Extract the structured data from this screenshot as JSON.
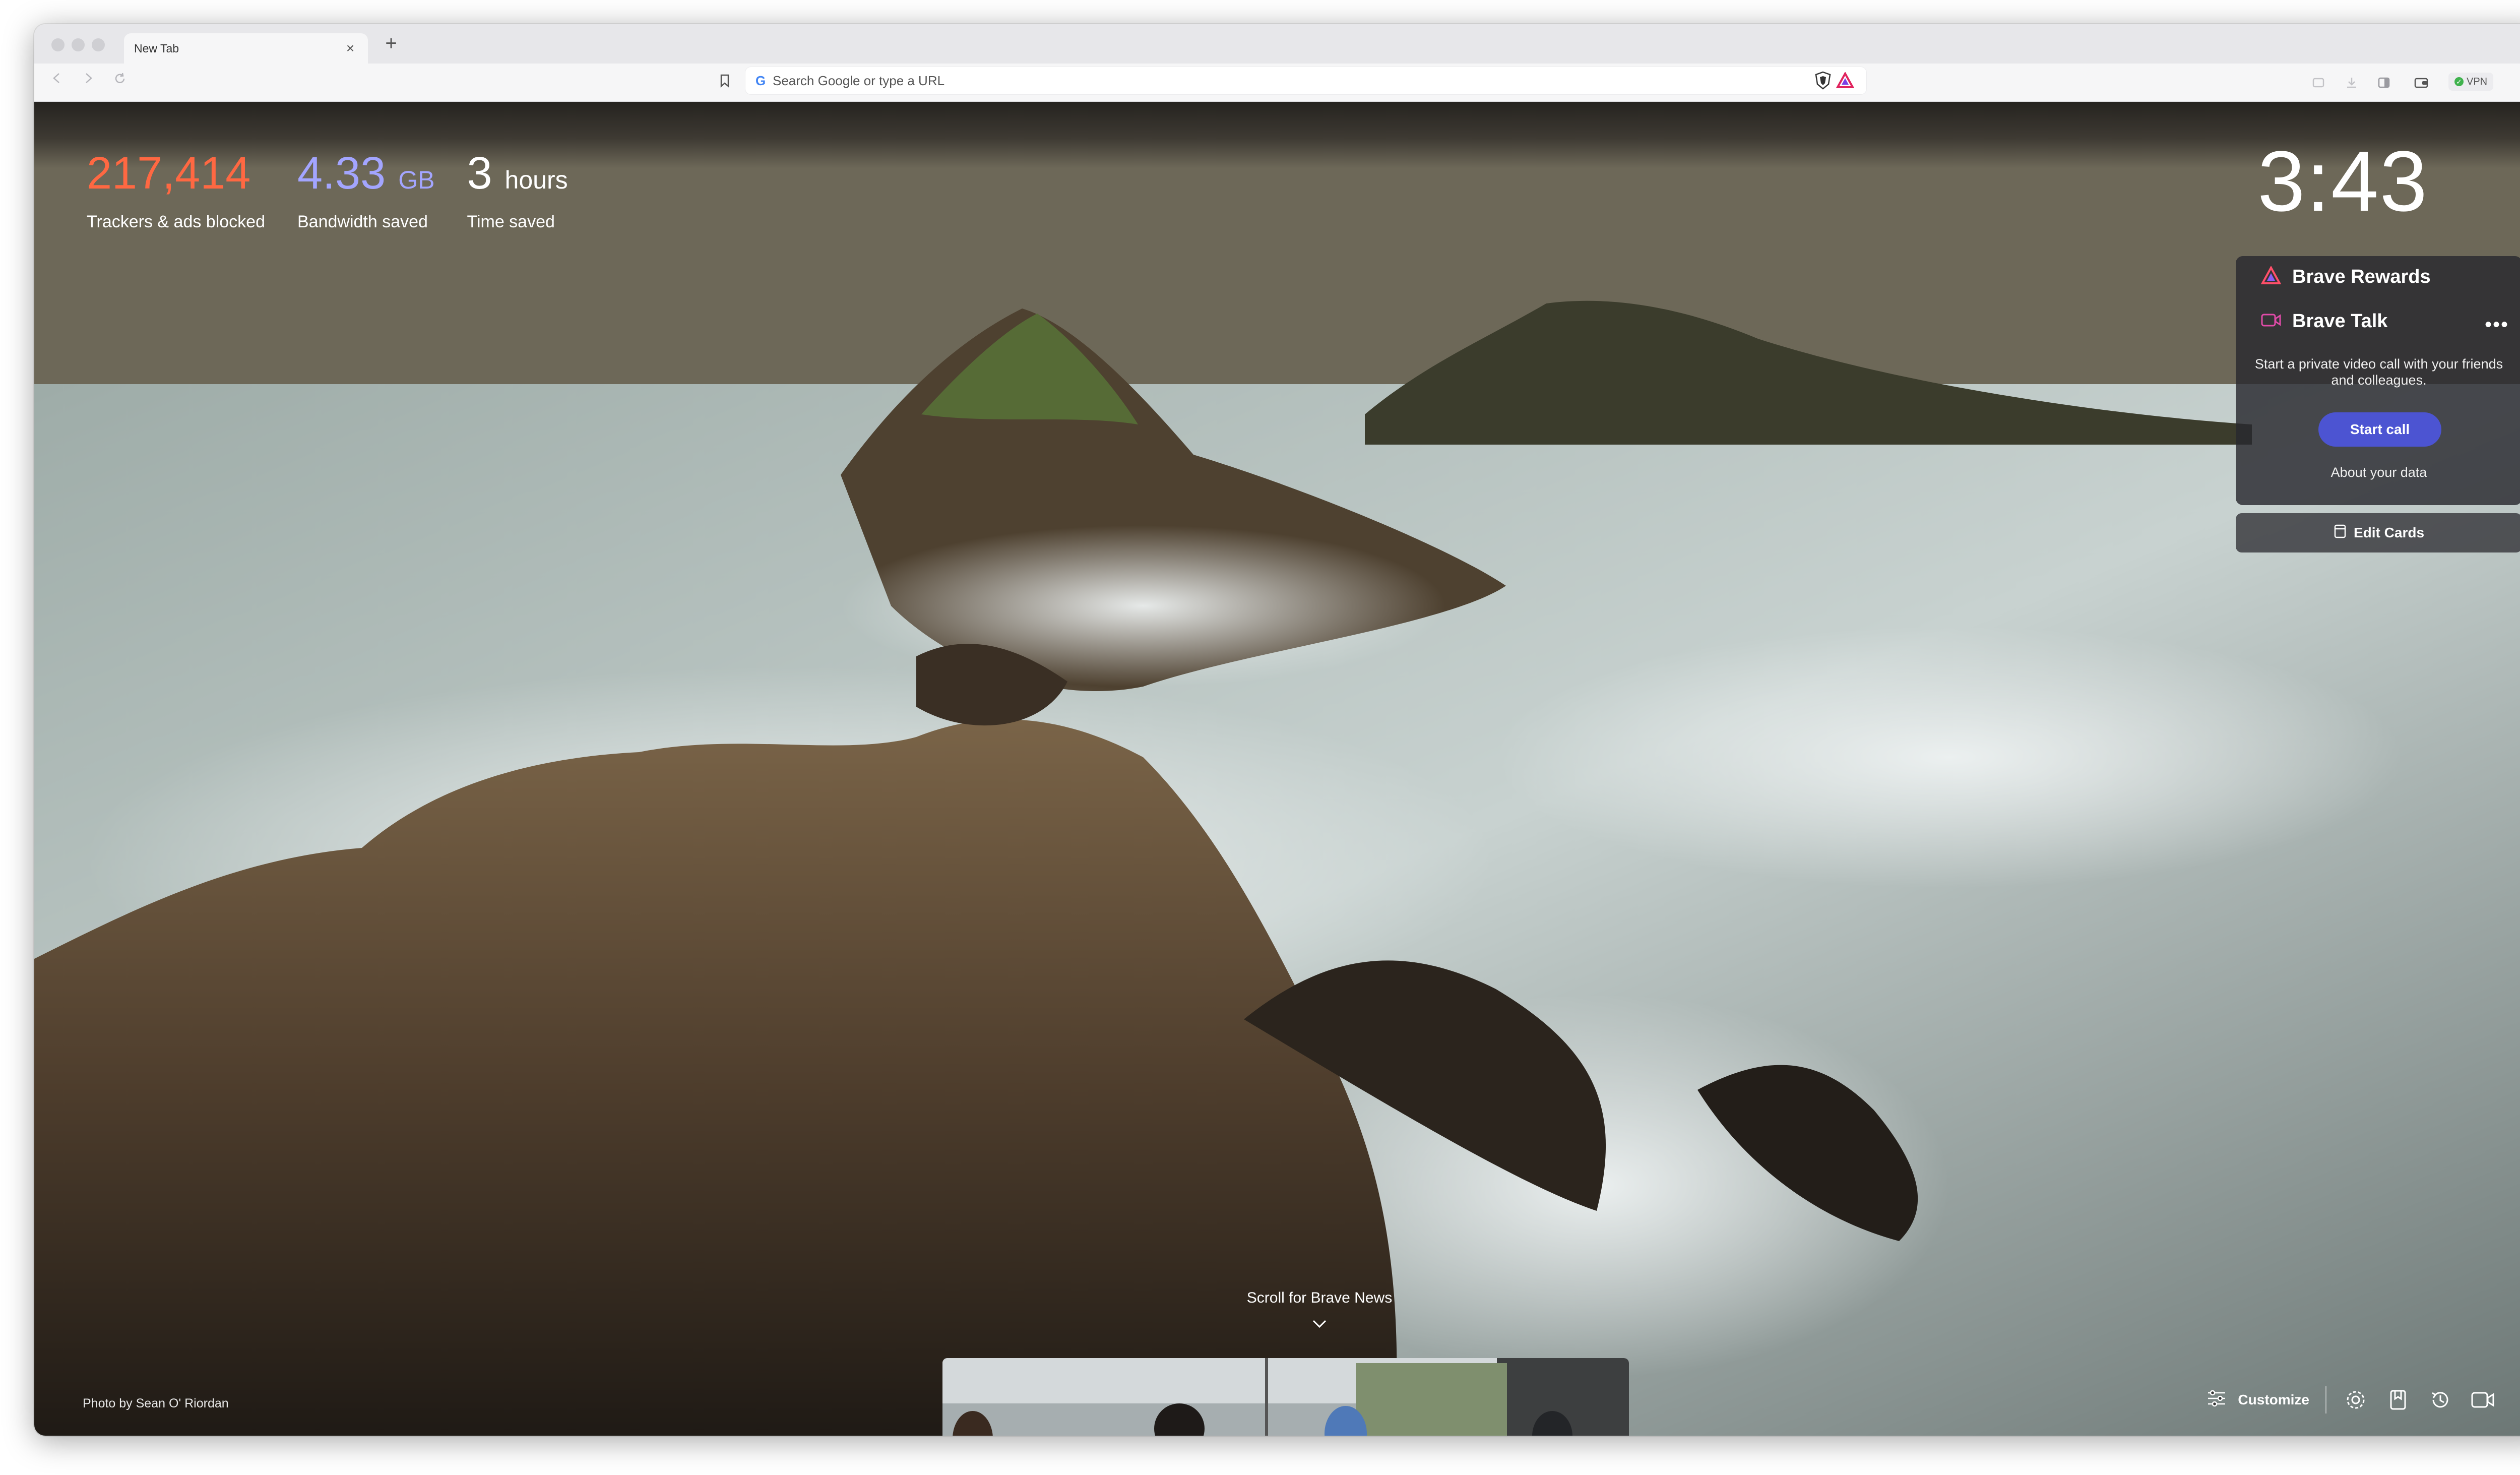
{
  "browser": {
    "tab_title": "New Tab",
    "tab_close": "×",
    "new_tab": "+",
    "omnibox_placeholder": "Search Google or type a URL",
    "omnibox_engine_glyph": "G",
    "vpn_label": "VPN",
    "vpn_check": "✓"
  },
  "stats": [
    {
      "value": "217,414",
      "unit": "",
      "label": "Trackers & ads blocked",
      "color": "#ff6842"
    },
    {
      "value": "4.33",
      "unit": "GB",
      "label": "Bandwidth saved",
      "color": "#a3a5ff"
    },
    {
      "value": "3",
      "unit": "hours",
      "label": "Time saved",
      "color": "#ffffff"
    }
  ],
  "clock": "3:43",
  "widget": {
    "rewards_title": "Brave Rewards",
    "talk_title": "Brave Talk",
    "more_glyph": "•••",
    "talk_desc": "Start a private video call with your friends and colleagues.",
    "start_call": "Start call",
    "about_data": "About your data",
    "edit_cards": "Edit Cards"
  },
  "scroll_news": "Scroll for Brave News",
  "photo_credit": "Photo by Sean O' Riordan",
  "customize": "Customize",
  "colors": {
    "accent": "#4c54d2",
    "brave_orange": "#ff6842",
    "bandwidth_purple": "#a3a5ff"
  },
  "icons": [
    "back-icon",
    "forward-icon",
    "reload-icon",
    "bookmark-icon",
    "brave-shields-icon",
    "brave-rewards-icon",
    "sidebar-icon",
    "wallet-icon",
    "menu-icon",
    "settings-icon",
    "bookmarks-icon",
    "history-icon",
    "brave-talk-icon",
    "customize-sliders-icon"
  ]
}
